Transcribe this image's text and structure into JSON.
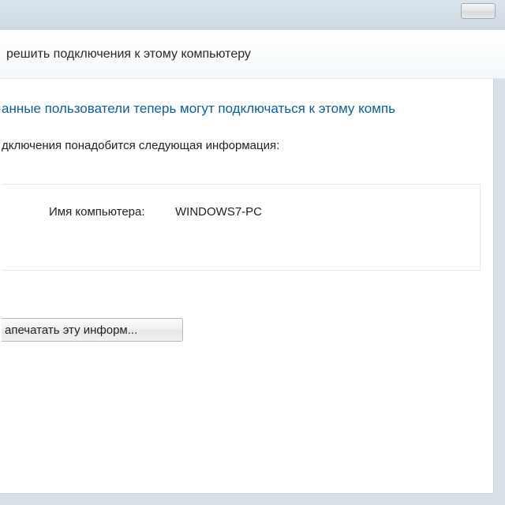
{
  "header": {
    "title": "решить подключения к этому компьютеру"
  },
  "main": {
    "heading": "анные пользователи теперь могут подключаться к этому компь",
    "info_text": "дключения понадобится следующая информация:",
    "computer_name_label": "Имя компьютера:",
    "computer_name_value": "WINDOWS7-PC"
  },
  "buttons": {
    "print_label": "апечатать эту информ..."
  }
}
